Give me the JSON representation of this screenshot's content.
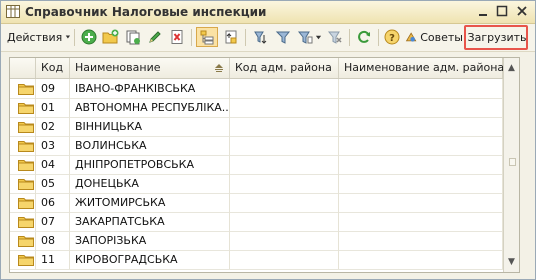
{
  "window": {
    "title": "Справочник Налоговые инспекции",
    "minimize_icon": "minimize-icon",
    "maximize_icon": "maximize-icon",
    "close_icon": "close-icon"
  },
  "toolbar": {
    "actions_label": "Действия",
    "tips_label": "Советы",
    "load_label": "Загрузить",
    "highlight_color": "#e8554b"
  },
  "table": {
    "columns": [
      "Код",
      "Наименование",
      "Код адм. района",
      "Наименование адм. района"
    ],
    "rows": [
      {
        "code": "09",
        "name": "ІВАНО-ФРАНКІВСЬКА",
        "district_code": "",
        "district_name": ""
      },
      {
        "code": "01",
        "name": "АВТОНОМНА РЕСПУБЛІКА...",
        "district_code": "",
        "district_name": ""
      },
      {
        "code": "02",
        "name": "ВІННИЦЬКА",
        "district_code": "",
        "district_name": ""
      },
      {
        "code": "03",
        "name": "ВОЛИНСЬКА",
        "district_code": "",
        "district_name": ""
      },
      {
        "code": "04",
        "name": "ДНІПРОПЕТРОВСЬКА",
        "district_code": "",
        "district_name": ""
      },
      {
        "code": "05",
        "name": "ДОНЕЦЬКА",
        "district_code": "",
        "district_name": ""
      },
      {
        "code": "06",
        "name": "ЖИТОМИРСЬКА",
        "district_code": "",
        "district_name": ""
      },
      {
        "code": "07",
        "name": "ЗАКАРПАТСЬКА",
        "district_code": "",
        "district_name": ""
      },
      {
        "code": "08",
        "name": "ЗАПОРІЗЬКА",
        "district_code": "",
        "district_name": ""
      },
      {
        "code": "11",
        "name": "КІРОВОГРАДСЬКА",
        "district_code": "",
        "district_name": ""
      }
    ]
  }
}
